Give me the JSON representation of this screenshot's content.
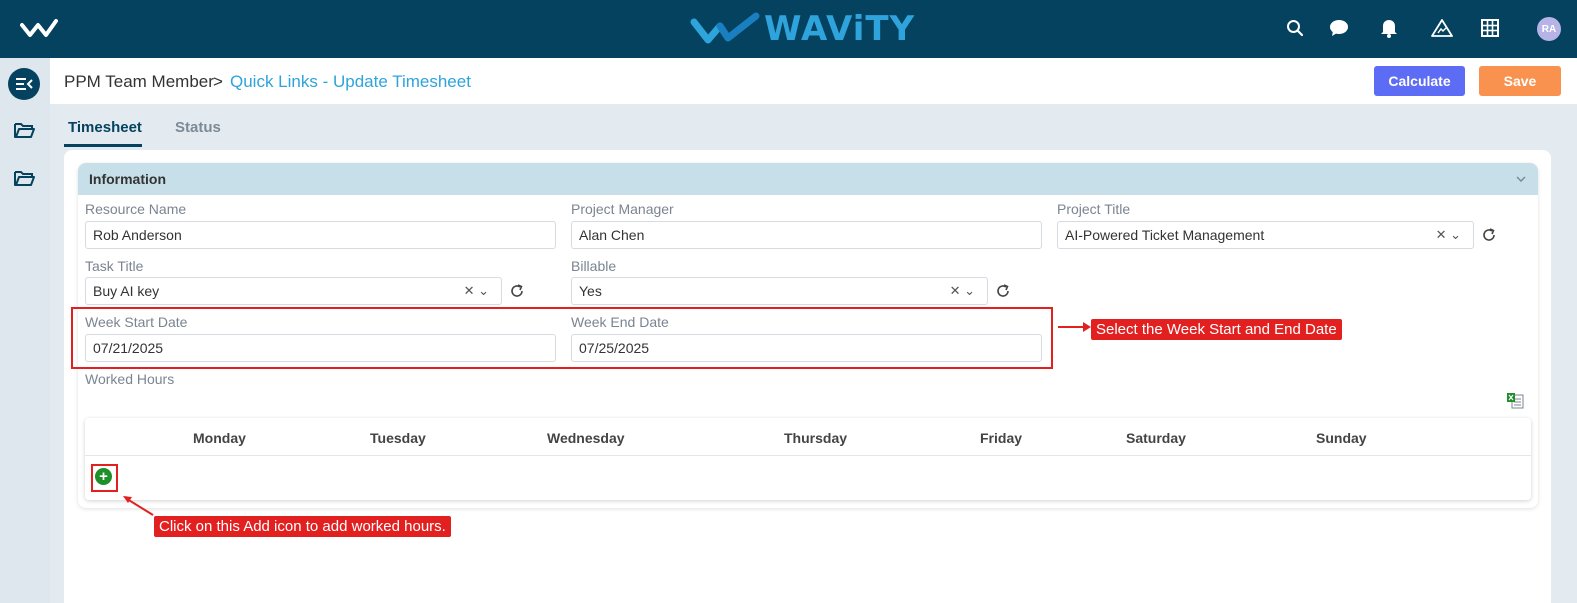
{
  "topbar": {
    "brand": "WAViTY",
    "avatar_initials": "RA",
    "icons": [
      "search-icon",
      "chat-icon",
      "bell-icon",
      "alert-triangle-icon",
      "grid-icon"
    ]
  },
  "header": {
    "breadcrumb_root": "PPM Team Member",
    "breadcrumb_sep": ">",
    "breadcrumb_current": "Quick Links - Update Timesheet",
    "calculate_label": "Calculate",
    "save_label": "Save"
  },
  "tabs": [
    {
      "label": "Timesheet",
      "active": true
    },
    {
      "label": "Status",
      "active": false
    }
  ],
  "section": {
    "title": "Information",
    "resource_name": {
      "label": "Resource Name",
      "value": "Rob Anderson"
    },
    "project_manager": {
      "label": "Project Manager",
      "value": "Alan Chen"
    },
    "project_title": {
      "label": "Project Title",
      "value": "AI-Powered Ticket Management"
    },
    "task_title": {
      "label": "Task Title",
      "value": "Buy AI key"
    },
    "billable": {
      "label": "Billable",
      "value": "Yes"
    },
    "week_start": {
      "label": "Week Start Date",
      "value": "07/21/2025"
    },
    "week_end": {
      "label": "Week End Date",
      "value": "07/25/2025"
    },
    "worked_hours_label": "Worked Hours"
  },
  "hours_table": {
    "columns": [
      "Monday",
      "Tuesday",
      "Wednesday",
      "Thursday",
      "Friday",
      "Saturday",
      "Sunday"
    ],
    "add_symbol": "+"
  },
  "annotations": {
    "week_callout": "Select the Week Start and End Date",
    "add_callout": "Click on this Add icon to add worked hours."
  },
  "colors": {
    "topbar": "#04425f",
    "brand": "#2ea3dc",
    "calculate": "#5c6cf4",
    "save": "#f9924f",
    "annotation": "#e32020",
    "add": "#1f8f2a"
  }
}
